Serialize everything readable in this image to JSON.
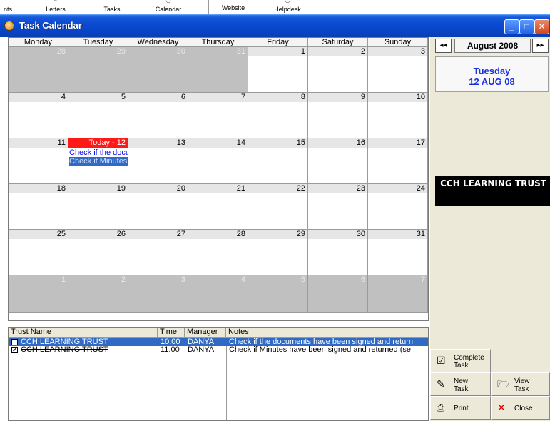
{
  "toolbar": {
    "items": [
      {
        "label": "nts"
      },
      {
        "label": "Letters"
      },
      {
        "label": "Tasks"
      },
      {
        "label": "Calendar"
      },
      {
        "label": "Website"
      },
      {
        "label": "Helpdesk"
      }
    ]
  },
  "window": {
    "title": "Task Calendar",
    "min_glyph": "_",
    "max_glyph": "□",
    "close_glyph": "✕"
  },
  "calendar": {
    "days": [
      "Monday",
      "Tuesday",
      "Wednesday",
      "Thursday",
      "Friday",
      "Saturday",
      "Sunday"
    ],
    "weeks": [
      [
        {
          "n": "28",
          "out": true
        },
        {
          "n": "29",
          "out": true
        },
        {
          "n": "30",
          "out": true
        },
        {
          "n": "31",
          "out": true
        },
        {
          "n": "1"
        },
        {
          "n": "2"
        },
        {
          "n": "3"
        }
      ],
      [
        {
          "n": "4"
        },
        {
          "n": "5"
        },
        {
          "n": "6"
        },
        {
          "n": "7"
        },
        {
          "n": "8"
        },
        {
          "n": "9"
        },
        {
          "n": "10"
        }
      ],
      [
        {
          "n": "11"
        },
        {
          "n": "Today - 12",
          "today": true,
          "tasks": [
            {
              "text": "Check if the docu",
              "selected": false
            },
            {
              "text": "Check if Minutes h",
              "selected": true
            }
          ]
        },
        {
          "n": "13"
        },
        {
          "n": "14"
        },
        {
          "n": "15"
        },
        {
          "n": "16"
        },
        {
          "n": "17"
        }
      ],
      [
        {
          "n": "18"
        },
        {
          "n": "19"
        },
        {
          "n": "20"
        },
        {
          "n": "21"
        },
        {
          "n": "22"
        },
        {
          "n": "23"
        },
        {
          "n": "24"
        }
      ],
      [
        {
          "n": "25"
        },
        {
          "n": "26"
        },
        {
          "n": "27"
        },
        {
          "n": "28"
        },
        {
          "n": "29"
        },
        {
          "n": "30"
        },
        {
          "n": "31"
        }
      ],
      [
        {
          "n": "1",
          "out": true
        },
        {
          "n": "2",
          "out": true
        },
        {
          "n": "3",
          "out": true
        },
        {
          "n": "4",
          "out": true
        },
        {
          "n": "5",
          "out": true
        },
        {
          "n": "6",
          "out": true
        },
        {
          "n": "7",
          "out": true
        }
      ]
    ]
  },
  "side": {
    "prev": "◂◂",
    "next": "▸▸",
    "month": "August 2008",
    "weekday": "Tuesday",
    "date": "12 AUG 08",
    "trust": "CCH LEARNING TRUST"
  },
  "tasklist": {
    "headers": {
      "trust": "Trust Name",
      "time": "Time",
      "manager": "Manager",
      "notes": "Notes"
    },
    "rows": [
      {
        "checked": false,
        "trust": "CCH LEARNING TRUST",
        "time": "10:00",
        "manager": "DANYA",
        "notes": "Check if the documents have been signed and return",
        "selected": true
      },
      {
        "checked": true,
        "trust": "CCH LEARNING TRUST",
        "time": "11:00",
        "manager": "DANYA",
        "notes": "Check if Minutes have been signed and returned (se",
        "selected": false
      }
    ]
  },
  "actions": {
    "complete": "Complete Task",
    "complete_l1": "Complete",
    "complete_l2": "Task",
    "new_l1": "New",
    "new_l2": "Task",
    "view_l1": "View",
    "view_l2": "Task",
    "print": "Print",
    "close": "Close"
  },
  "colors": {
    "today": "#ff1a1a",
    "selection": "#316ac5",
    "task_text": "#0000ff",
    "date_text": "#1a30e0"
  }
}
